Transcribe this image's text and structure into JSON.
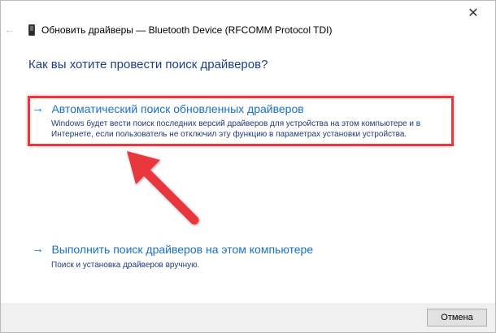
{
  "window": {
    "title": "Обновить драйверы — Bluetooth Device (RFCOMM Protocol TDI)",
    "close_label": "✕",
    "back_glyph": "←"
  },
  "heading": "Как вы хотите провести поиск драйверов?",
  "options": [
    {
      "arrow": "→",
      "title": "Автоматический поиск обновленных драйверов",
      "description_line1": "Windows будет вести поиск последних версий драйверов для устройства на этом компьютере и в",
      "description_line2": "Интернете, если пользователь не отключил эту функцию в параметрах установки устройства."
    },
    {
      "arrow": "→",
      "title": "Выполнить поиск драйверов на этом компьютере",
      "description_line1": "Поиск и установка драйверов вручную."
    }
  ],
  "footer": {
    "cancel_label": "Отмена"
  },
  "colors": {
    "link": "#1a6fc9",
    "heading": "#1e3f82",
    "highlight": "#e8383d"
  },
  "icons": [
    "back-arrow-icon",
    "device-icon",
    "close-icon",
    "pointer-arrow-annotation"
  ]
}
